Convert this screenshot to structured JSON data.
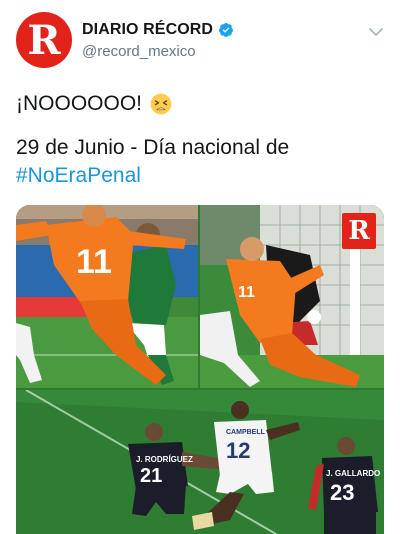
{
  "author": {
    "display_name": "DIARIO RÉCORD",
    "handle": "@record_mexico",
    "avatar_letter": "R",
    "verified_icon": "verified-badge-icon",
    "brand_color": "#e2231a"
  },
  "tweet": {
    "line1": "¡NOOOOOO!",
    "line1_emoji": "tired-face-emoji",
    "line2": "29 de Junio - Día nacional de",
    "hashtag": "#NoEraPenal",
    "hashtag_color": "#1b95e0"
  },
  "media": {
    "logo_letter": "R",
    "jersey_numbers": {
      "orange_left": "11",
      "orange_right": "11",
      "white_player": "12",
      "dark_left": "21",
      "dark_right": "23"
    },
    "jersey_names": {
      "white_player": "CAMPBELL",
      "dark_left": "J. RODRÍGUEZ",
      "dark_right": "J. GALLARDO"
    }
  }
}
